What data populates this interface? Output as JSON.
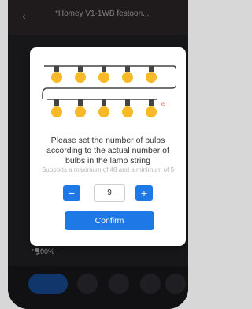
{
  "header": {
    "title": "*Homey V1-1WB festoon..."
  },
  "dialog": {
    "description": "Please set the number of bulbs according to the actual number of bulbs in the lamp string",
    "hint": "Supports a maximum of 48 and a minimum of 5",
    "quantity": "9",
    "minus_label": "−",
    "plus_label": "+",
    "confirm_label": "Confirm",
    "x_mark": "x5"
  },
  "status": {
    "brightness_text": "100%"
  },
  "colors": {
    "accent": "#1e78e6",
    "bulb": "#f7b928"
  },
  "icons": [
    "back-icon",
    "brightness-icon",
    "bulb-icon"
  ]
}
